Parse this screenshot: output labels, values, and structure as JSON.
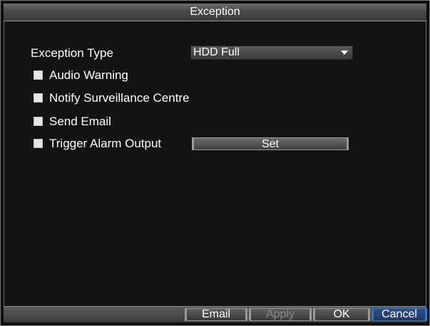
{
  "dialog": {
    "title": "Exception"
  },
  "exception_type": {
    "label": "Exception Type",
    "selected": "HDD Full"
  },
  "options": [
    {
      "label": "Audio Warning",
      "checked": false
    },
    {
      "label": "Notify Surveillance Centre",
      "checked": false
    },
    {
      "label": "Send Email",
      "checked": false
    },
    {
      "label": "Trigger Alarm Output",
      "checked": false
    }
  ],
  "set_button": {
    "label": "Set"
  },
  "footer": {
    "email_label": "Email",
    "apply_label": "Apply",
    "ok_label": "OK",
    "cancel_label": "Cancel"
  }
}
